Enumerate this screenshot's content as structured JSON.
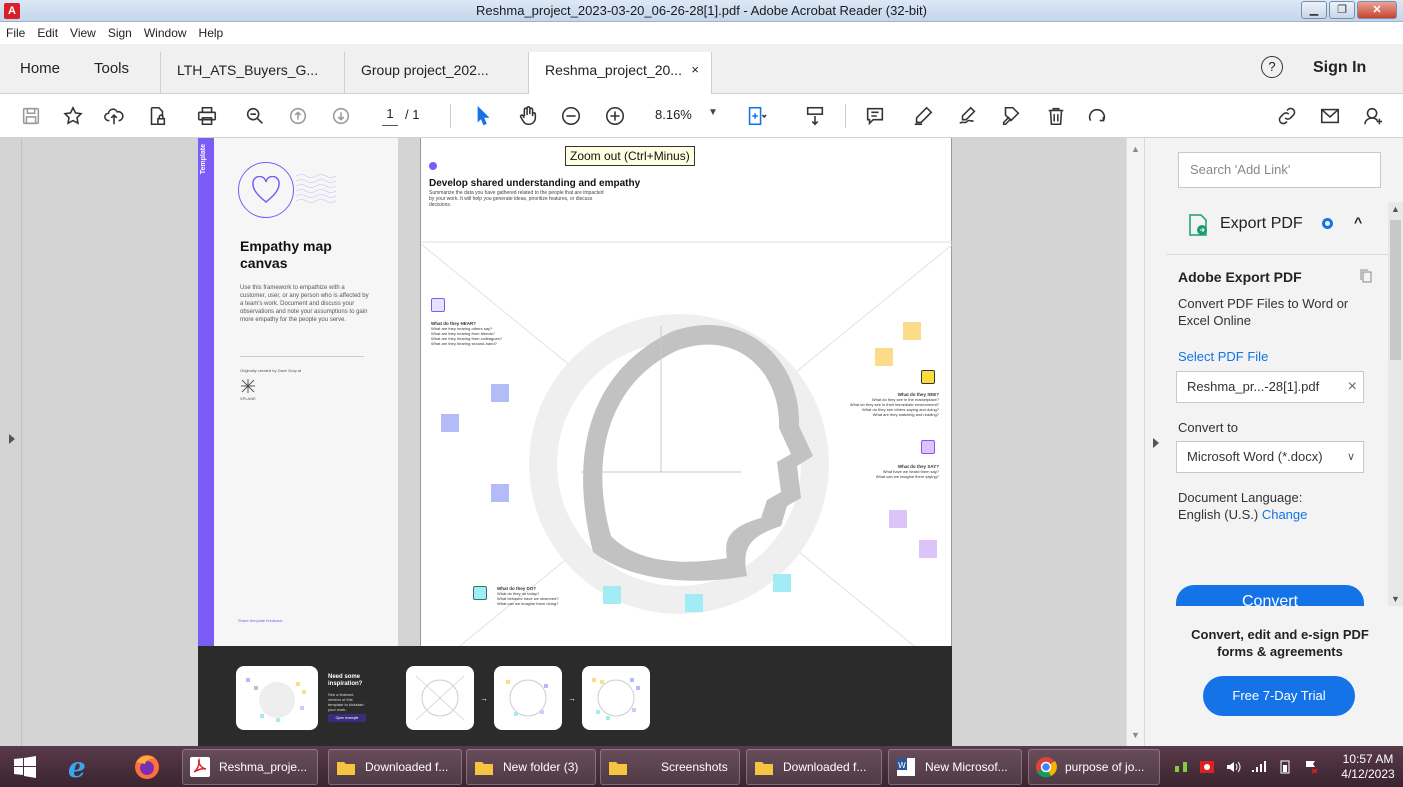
{
  "window": {
    "title": "Reshma_project_2023-03-20_06-26-28[1].pdf - Adobe Acrobat Reader (32-bit)",
    "app_icon": "acrobat-icon",
    "controls": [
      "minimize",
      "maximize",
      "close"
    ]
  },
  "menu": [
    "File",
    "Edit",
    "View",
    "Sign",
    "Window",
    "Help"
  ],
  "tabs": {
    "home": "Home",
    "tools": "Tools",
    "documents": [
      {
        "label": "LTH_ATS_Buyers_G...",
        "active": false
      },
      {
        "label": "Group project_202...",
        "active": false
      },
      {
        "label": "Reshma_project_20...",
        "active": true,
        "close": "×"
      }
    ],
    "help": "?",
    "sign_in": "Sign In"
  },
  "toolbar": {
    "page_current": "1",
    "page_total": "/ 1",
    "zoom": "8.16%",
    "zoom_arrow": "▼",
    "icons": [
      "save-icon",
      "star-icon",
      "upload-icon",
      "protect-icon",
      "print-icon",
      "search-zoom-icon",
      "page-up-icon",
      "page-down-icon",
      "select-icon",
      "hand-icon",
      "zoom-out-icon",
      "zoom-in-icon",
      "fit-page-icon",
      "scroll-mode-icon",
      "comment-icon",
      "highlight-icon",
      "sign-icon",
      "stamp-icon",
      "delete-icon",
      "rotate-icon",
      "link-icon",
      "email-icon",
      "share-user-icon"
    ]
  },
  "tooltip": "Zoom out (Ctrl+Minus)",
  "document": {
    "template_label": "Template",
    "title": "Empathy map canvas",
    "intro": "Use this framework to empathize with a customer, user, or any person who is affected by a team's work. Document and discuss your observations and note your assumptions to gain more empathy for the people you serve.",
    "credit": "Originally created by Dave Gray at",
    "credit_org": "XPLANE",
    "feedback": "Share template feedback",
    "header_title": "Develop shared understanding and empathy",
    "header_desc": "Summarize the data you have gathered related to the people that are impacted by your work. It will help you generate ideas, prioritize features, or discuss decisions.",
    "hear": {
      "title": "What do they HEAR?",
      "lines": [
        "What are they hearing others say?",
        "What are they hearing from friends?",
        "What are they hearing from colleagues?",
        "What are they hearing second-hand?"
      ]
    },
    "see": {
      "title": "What do they SEE?",
      "lines": [
        "What do they see in the marketplace?",
        "What do they see in their immediate environment?",
        "What do they see others saying and doing?",
        "What are they watching and reading?"
      ]
    },
    "say": {
      "title": "What do they SAY?",
      "lines": [
        "What have we heard them say?",
        "What can we imagine them saying?"
      ]
    },
    "do": {
      "title": "What do they DO?",
      "lines": [
        "What do they do today?",
        "What behavior have we observed?",
        "What can we imagine them doing?"
      ]
    },
    "inspiration": {
      "title": "Need some inspiration?",
      "text": "See a finished version of this template to kickstart your work.",
      "button": "Open example"
    },
    "colors": {
      "purple": "#7c5cf6",
      "yellow": "#fcdc8a",
      "blue": "#b4bcf8",
      "cyan": "#a2ecf6",
      "lavender": "#dcc4f8"
    }
  },
  "panel": {
    "search_placeholder": "Search 'Add Link'",
    "export_title": "Export PDF",
    "caret": "^",
    "section_title": "Adobe Export PDF",
    "description": "Convert PDF Files to Word or Excel Online",
    "select_file": "Select PDF File",
    "file_name": "Reshma_pr...-28[1].pdf",
    "file_clear": "×",
    "convert_to": "Convert to",
    "format": "Microsoft Word (*.docx)",
    "format_arrow": "∨",
    "language_label": "Document Language:",
    "language": "English (U.S.)",
    "change": "Change",
    "convert_button": "Convert",
    "promo_text": "Convert, edit and e-sign PDF forms & agreements",
    "trial_button": "Free 7-Day Trial"
  },
  "taskbar": {
    "tasks": [
      {
        "label": "Reshma_proje...",
        "icon": "acrobat-icon"
      },
      {
        "label": "Downloaded f...",
        "icon": "folder-icon"
      },
      {
        "label": "New folder (3)",
        "icon": "folder-icon"
      },
      {
        "label": "Screenshots",
        "icon": "folder-icon"
      },
      {
        "label": "Downloaded f...",
        "icon": "folder-icon"
      },
      {
        "label": "New Microsof...",
        "icon": "word-icon"
      },
      {
        "label": "purpose of jo...",
        "icon": "chrome-icon"
      }
    ],
    "time": "10:57 AM",
    "date": "4/12/2023"
  }
}
